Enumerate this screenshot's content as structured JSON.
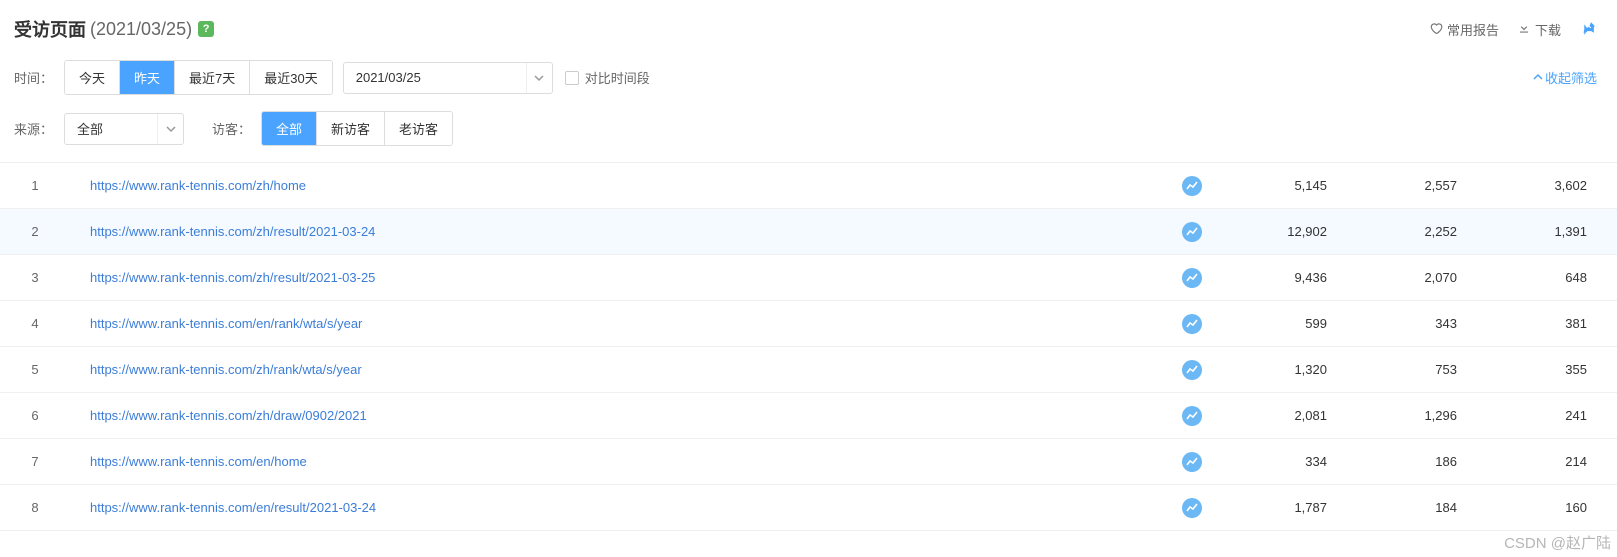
{
  "header": {
    "title": "受访页面",
    "date": "(2021/03/25)",
    "help": "?",
    "actions": {
      "fav": "常用报告",
      "download": "下载"
    }
  },
  "filters": {
    "time_label": "时间：",
    "time_options": [
      "今天",
      "昨天",
      "最近7天",
      "最近30天"
    ],
    "time_active_idx": 1,
    "date_value": "2021/03/25",
    "compare_label": "对比时间段",
    "collapse_label": "收起筛选",
    "source_label": "来源：",
    "source_value": "全部",
    "visitor_label": "访客：",
    "visitor_options": [
      "全部",
      "新访客",
      "老访客"
    ],
    "visitor_active_idx": 0
  },
  "table": {
    "rows": [
      {
        "idx": "1",
        "url": "https://www.rank-tennis.com/zh/home",
        "c1": "5,145",
        "c2": "2,557",
        "c3": "3,602",
        "hl": false
      },
      {
        "idx": "2",
        "url": "https://www.rank-tennis.com/zh/result/2021-03-24",
        "c1": "12,902",
        "c2": "2,252",
        "c3": "1,391",
        "hl": true
      },
      {
        "idx": "3",
        "url": "https://www.rank-tennis.com/zh/result/2021-03-25",
        "c1": "9,436",
        "c2": "2,070",
        "c3": "648",
        "hl": false
      },
      {
        "idx": "4",
        "url": "https://www.rank-tennis.com/en/rank/wta/s/year",
        "c1": "599",
        "c2": "343",
        "c3": "381",
        "hl": false
      },
      {
        "idx": "5",
        "url": "https://www.rank-tennis.com/zh/rank/wta/s/year",
        "c1": "1,320",
        "c2": "753",
        "c3": "355",
        "hl": false
      },
      {
        "idx": "6",
        "url": "https://www.rank-tennis.com/zh/draw/0902/2021",
        "c1": "2,081",
        "c2": "1,296",
        "c3": "241",
        "hl": false
      },
      {
        "idx": "7",
        "url": "https://www.rank-tennis.com/en/home",
        "c1": "334",
        "c2": "186",
        "c3": "214",
        "hl": false
      },
      {
        "idx": "8",
        "url": "https://www.rank-tennis.com/en/result/2021-03-24",
        "c1": "1,787",
        "c2": "184",
        "c3": "160",
        "hl": false
      }
    ]
  },
  "watermark": "CSDN @赵广陆"
}
